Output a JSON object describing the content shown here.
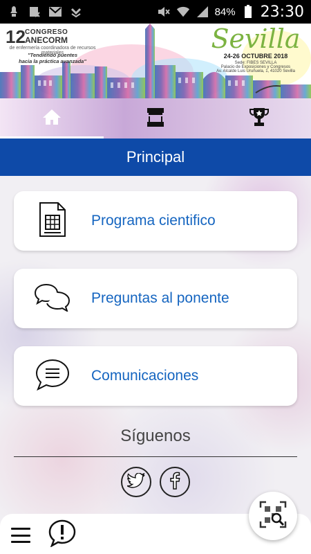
{
  "status_bar": {
    "battery": "84%",
    "time": "23:30"
  },
  "banner": {
    "congress_number": "12",
    "congress_word": "CONGRESO",
    "congress_org": "ANECORM",
    "congress_subtitle": "de enfermería coordinadora de recursos materiales",
    "tagline_line1": "\"Tendiendo puentes",
    "tagline_line2": "hacia la práctica avanzada\"",
    "city": "Sevilla",
    "dates": "24-26 OCTUBRE 2018",
    "venue_line1": "Sede: FIBES SEVILLA",
    "venue_line2": "Palacio de Exposiciones y Congresos",
    "venue_line3": "Av. Alcalde Luis Uruñuela, 1, 41020 Sevilla"
  },
  "tabs": [
    {
      "icon": "home-icon"
    },
    {
      "icon": "stand-icon"
    },
    {
      "icon": "trophy-icon"
    }
  ],
  "title": "Principal",
  "menu_cards": [
    {
      "icon": "document-icon",
      "label": "Programa cientifico"
    },
    {
      "icon": "chat-bubbles-icon",
      "label": "Preguntas al ponente"
    },
    {
      "icon": "message-icon",
      "label": "Comunicaciones"
    }
  ],
  "follow": {
    "title": "Síguenos",
    "networks": [
      "twitter-icon",
      "facebook-icon"
    ]
  },
  "colors": {
    "title_bar": "#0e4aa8",
    "card_label": "#1565c0",
    "city": "#7cb342"
  }
}
